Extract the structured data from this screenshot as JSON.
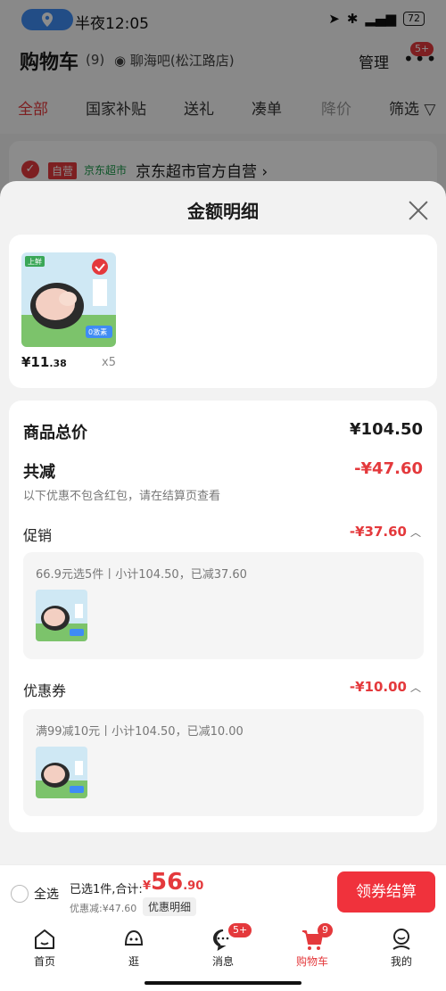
{
  "status": {
    "time": "半夜12:05",
    "battery": "72"
  },
  "header": {
    "title": "购物车",
    "count": "(9)",
    "store": "聊海吧(松江路店)",
    "manage": "管理",
    "more_badge": "5+"
  },
  "filter_tabs": [
    "全部",
    "国家补贴",
    "送礼",
    "凑单",
    "降价",
    "筛选"
  ],
  "shop": {
    "tag": "自营",
    "market": "京东超市",
    "name": "京东超市官方自营 ›"
  },
  "sheet": {
    "title": "金额明细",
    "product": {
      "price_int": "¥11",
      "price_dec": ".38",
      "qty": "x5",
      "thumb_brand": "上鲜",
      "thumb_tag": "0激素"
    },
    "total_label": "商品总价",
    "total_value": "¥104.50",
    "reduce_label": "共减",
    "reduce_value": "-¥47.60",
    "reduce_note": "以下优惠不包含红包，请在结算页查看",
    "promo": {
      "label": "促销",
      "value": "-¥37.60",
      "detail": "66.9元选5件丨小计104.50，已减37.60"
    },
    "coupon": {
      "label": "优惠券",
      "value": "-¥10.00",
      "detail": "满99减10元丨小计104.50，已减10.00"
    }
  },
  "settle": {
    "select_all": "全选",
    "summary": "已选1件,合计:",
    "price_cur": "¥",
    "price_int": "56",
    "price_dec": ".90",
    "discount": "优惠减:¥47.60",
    "detail_chip": "优惠明细",
    "checkout": "领券结算"
  },
  "tabbar": {
    "items": [
      {
        "label": "首页"
      },
      {
        "label": "逛"
      },
      {
        "label": "消息",
        "badge": "5+"
      },
      {
        "label": "购物车",
        "badge": "9"
      },
      {
        "label": "我的"
      }
    ]
  },
  "colors": {
    "accent": "#e4393c",
    "checkout": "#f0323c",
    "green": "#1a9a4a"
  }
}
